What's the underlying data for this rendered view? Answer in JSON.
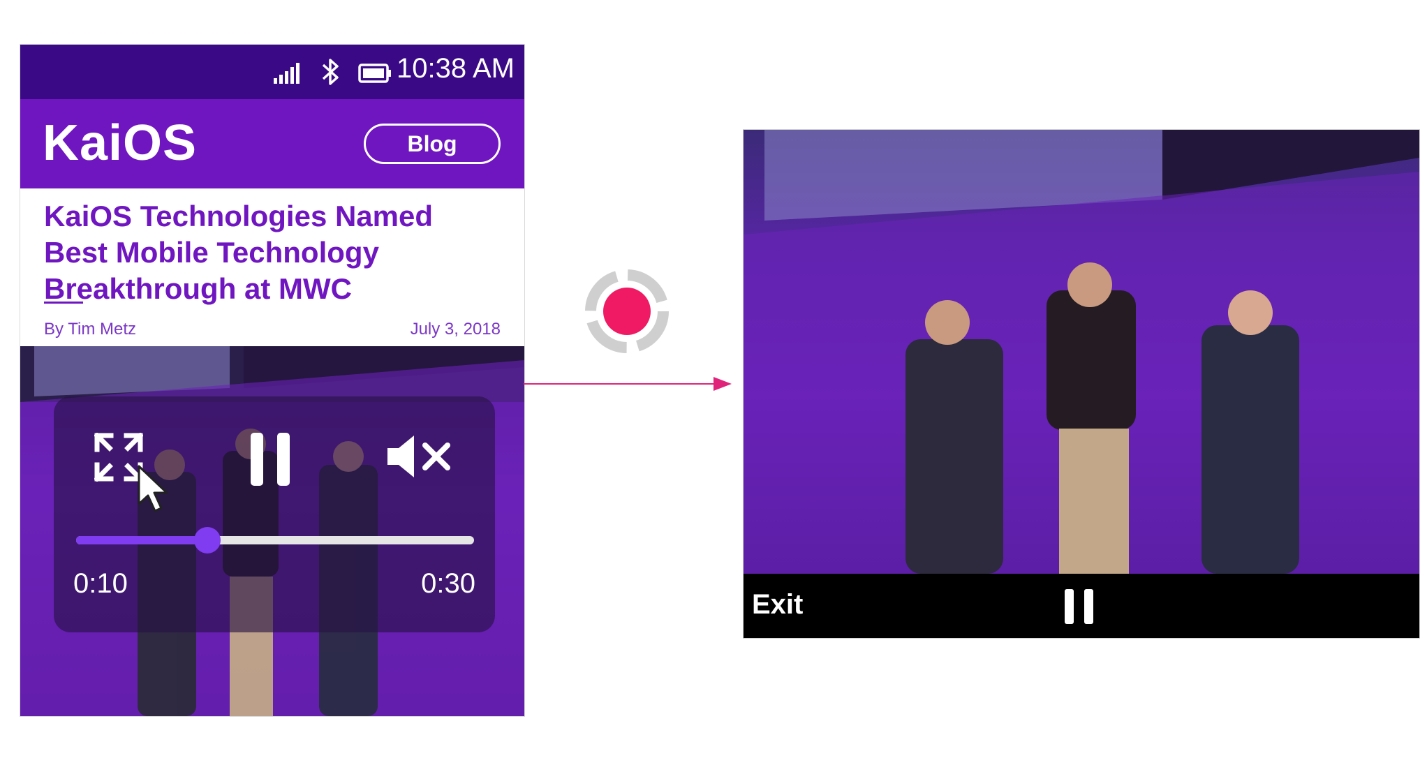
{
  "status_bar": {
    "time": "10:38 AM",
    "icons": [
      "signal-icon",
      "bluetooth-icon",
      "battery-icon"
    ]
  },
  "app_bar": {
    "logo_text": "KaiOS",
    "blog_button_label": "Blog"
  },
  "article": {
    "headline": "KaiOS Technologies Named Best Mobile Technology Breakthrough at MWC",
    "byline": "By Tim Metz",
    "date": "July 3, 2018"
  },
  "player": {
    "current_time": "0:10",
    "total_time": "0:30",
    "progress_percent": 33,
    "icons": [
      "fullscreen-icon",
      "pause-icon",
      "mute-icon",
      "cursor-icon"
    ]
  },
  "transition": {
    "icons": [
      "record-indicator-icon",
      "arrow-right-icon"
    ]
  },
  "fullscreen": {
    "exit_label": "Exit",
    "icons": [
      "pause-icon"
    ]
  },
  "colors": {
    "status_bar": "#3a0a86",
    "brand_purple": "#6f16c0",
    "accent_progress": "#7f3cf0",
    "record_pink": "#ef1a63",
    "arrow_pink": "#e0237a"
  }
}
